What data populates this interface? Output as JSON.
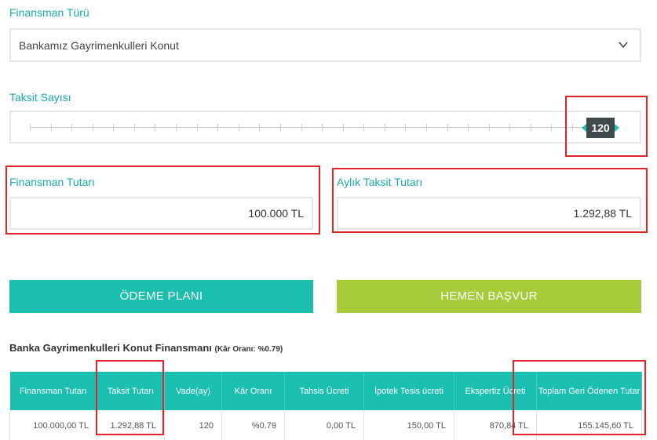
{
  "financing_type": {
    "label": "Finansman Türü",
    "selected": "Bankamız Gayrimenkulleri Konut"
  },
  "installments": {
    "label": "Taksit Sayısı",
    "value": "120"
  },
  "financing_amount": {
    "label": "Finansman Tutarı",
    "value": "100.000 TL"
  },
  "monthly_installment": {
    "label": "Aylık Taksit Tutarı",
    "value": "1.292,88 TL"
  },
  "buttons": {
    "plan": "ÖDEME PLANI",
    "apply": "HEMEN BAŞVUR"
  },
  "table": {
    "title": "Banka Gayrimenkulleri Konut Finansmanı",
    "subtitle": "(Kâr Oranı: %0.79)",
    "headers": [
      "Finansman Tutarı",
      "Taksit Tutarı",
      "Vade(ay)",
      "Kâr Oranı",
      "Tahsis Ücreti",
      "İpotek Tesis ücreti",
      "Ekspertiz Ücreti",
      "Toplam Geri Ödenen Tutar"
    ],
    "row": [
      "100.000,00 TL",
      "1.292,88 TL",
      "120",
      "%0.79",
      "0,00 TL",
      "150,00 TL",
      "870,84 TL",
      "155.145,60 TL"
    ]
  },
  "colors": {
    "accent": "#1bbfb0",
    "apply": "#a6cd39",
    "highlight": "#e0242b"
  }
}
